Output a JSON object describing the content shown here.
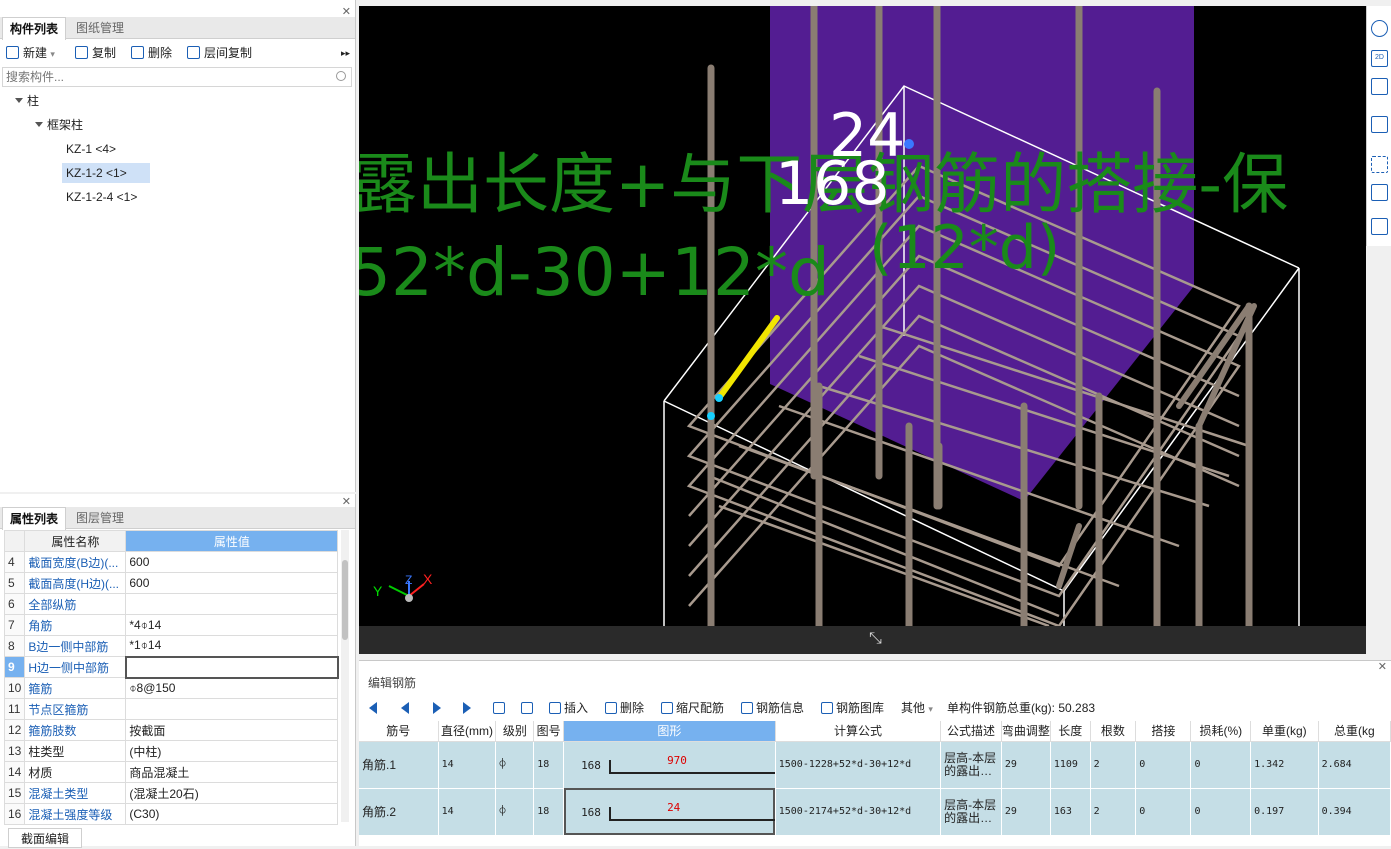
{
  "left_top": {
    "tabs": [
      "构件列表",
      "图纸管理"
    ],
    "toolbar": {
      "new": "新建",
      "copy": "复制",
      "delete": "删除",
      "floor_copy": "层间复制"
    },
    "search_placeholder": "搜索构件...",
    "tree": {
      "root": "柱",
      "group": "框架柱",
      "items": [
        "KZ-1 <4>",
        "KZ-1-2 <1>",
        "KZ-1-2-4 <1>"
      ]
    }
  },
  "left_bottom": {
    "tabs": [
      "属性列表",
      "图层管理"
    ],
    "headers": {
      "name": "属性名称",
      "value": "属性值"
    },
    "rows": [
      {
        "num": "4",
        "name": "截面宽度(B边)(...",
        "value": "600"
      },
      {
        "num": "5",
        "name": "截面高度(H边)(...",
        "value": "600"
      },
      {
        "num": "6",
        "name": "全部纵筋",
        "value": ""
      },
      {
        "num": "7",
        "name": "角筋",
        "value": "*4⌽14"
      },
      {
        "num": "8",
        "name": "B边一侧中部筋",
        "value": "*1⌽14"
      },
      {
        "num": "9",
        "name": "H边一侧中部筋",
        "value": ""
      },
      {
        "num": "10",
        "name": "箍筋",
        "value": "⌽8@150"
      },
      {
        "num": "11",
        "name": "节点区箍筋",
        "value": ""
      },
      {
        "num": "12",
        "name": "箍筋肢数",
        "value": "按截面"
      },
      {
        "num": "13",
        "name": "柱类型",
        "value": "(中柱)"
      },
      {
        "num": "14",
        "name": "材质",
        "value": "商品混凝土"
      },
      {
        "num": "15",
        "name": "混凝土类型",
        "value": "(混凝土20石)"
      },
      {
        "num": "16",
        "name": "混凝土强度等级",
        "value": "(C30)"
      }
    ],
    "bottom_tab": "截面编辑"
  },
  "viewport": {
    "line1": "露出长度+与下层钢筋的搭接-保",
    "line2": "52*d-30+12*d",
    "line2b": "(12*d)",
    "num_a": "24",
    "num_b": "168"
  },
  "view_tools": {
    "btn2d": "2D"
  },
  "edit_panel": {
    "title": "编辑钢筋",
    "tools": {
      "insert": "插入",
      "delete": "删除",
      "scale": "缩尺配筋",
      "info": "钢筋信息",
      "library": "钢筋图库",
      "other": "其他"
    },
    "total_label": "单构件钢筋总重(kg): 50.283",
    "headers": [
      "筋号",
      "直径(mm)",
      "级别",
      "图号",
      "图形",
      "计算公式",
      "公式描述",
      "弯曲调整",
      "长度",
      "根数",
      "搭接",
      "损耗(%)",
      "单重(kg)",
      "总重(kg"
    ],
    "rows": [
      {
        "idx": "3",
        "name": "角筋.1",
        "dia": "14",
        "grade": "⌽",
        "fig": "18",
        "shape_left": "168",
        "shape_val": "970",
        "formula": "1500-1228+52*d-30+12*d",
        "desc": "层高-本层的露出…",
        "bend": "29",
        "len": "1109",
        "count": "2",
        "lap": "0",
        "loss": "0",
        "unit": "1.342",
        "total": "2.684"
      },
      {
        "idx": "4",
        "name": "角筋.2",
        "dia": "14",
        "grade": "⌽",
        "fig": "18",
        "shape_left": "168",
        "shape_val": "24",
        "formula": "1500-2174+52*d-30+12*d",
        "desc": "层高-本层的露出…",
        "bend": "29",
        "len": "163",
        "count": "2",
        "lap": "0",
        "loss": "0",
        "unit": "0.197",
        "total": "0.394"
      }
    ]
  },
  "colors": {
    "accent": "#76b1ef",
    "overlay_green": "#1a8a1a",
    "purple": "#5a1f9e"
  }
}
